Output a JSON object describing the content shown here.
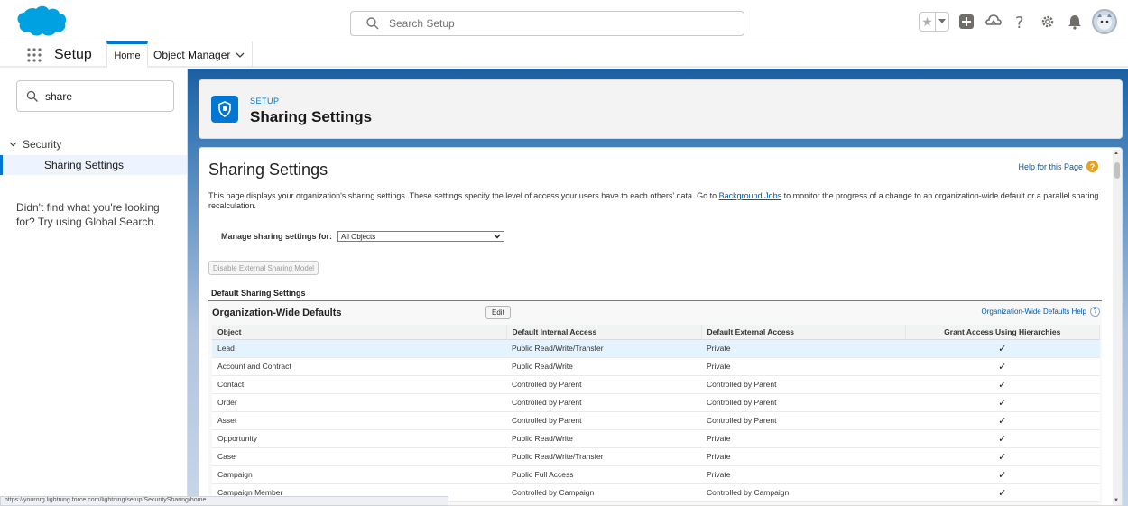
{
  "header": {
    "search_placeholder": "Search Setup",
    "brand_color": "#00a1e0",
    "icons": [
      "star-icon",
      "chevron-down-icon",
      "add-icon",
      "trailhead-icon",
      "help-icon",
      "gear-icon",
      "bell-icon",
      "avatar"
    ]
  },
  "nav": {
    "app_name": "Setup",
    "tabs": [
      {
        "label": "Home",
        "active": true
      },
      {
        "label": "Object Manager",
        "active": false
      }
    ]
  },
  "sidebar": {
    "quick_find_value": "share",
    "tree": {
      "label": "Security",
      "child": "Sharing Settings"
    },
    "not_found_text": "Didn't find what you're looking for? Try using Global Search."
  },
  "page_header": {
    "breadcrumb": "SETUP",
    "title": "Sharing Settings"
  },
  "content": {
    "title": "Sharing Settings",
    "help_link": "Help for this Page",
    "description_before": "This page displays your organization's sharing settings. These settings specify the level of access your users have to each others' data. Go to ",
    "description_link": "Background Jobs",
    "description_after": " to monitor the progress of a change to an organization-wide default or a parallel sharing recalculation.",
    "manage_label": "Manage sharing settings for:",
    "manage_value": "All Objects",
    "disable_button": "Disable External Sharing Model",
    "section_label": "Default Sharing Settings"
  },
  "owd": {
    "title": "Organization-Wide Defaults",
    "edit_button": "Edit",
    "help_link": "Organization-Wide Defaults Help",
    "columns": [
      "Object",
      "Default Internal Access",
      "Default External Access",
      "Grant Access Using Hierarchies"
    ],
    "rows": [
      {
        "object": "Lead",
        "internal": "Public Read/Write/Transfer",
        "external": "Private",
        "grant": "✓",
        "highlight": true
      },
      {
        "object": "Account and Contract",
        "internal": "Public Read/Write",
        "external": "Private",
        "grant": "✓"
      },
      {
        "object": "Contact",
        "internal": "Controlled by Parent",
        "external": "Controlled by Parent",
        "grant": "✓"
      },
      {
        "object": "Order",
        "internal": "Controlled by Parent",
        "external": "Controlled by Parent",
        "grant": "✓"
      },
      {
        "object": "Asset",
        "internal": "Controlled by Parent",
        "external": "Controlled by Parent",
        "grant": "✓"
      },
      {
        "object": "Opportunity",
        "internal": "Public Read/Write",
        "external": "Private",
        "grant": "✓"
      },
      {
        "object": "Case",
        "internal": "Public Read/Write/Transfer",
        "external": "Private",
        "grant": "✓"
      },
      {
        "object": "Campaign",
        "internal": "Public Full Access",
        "external": "Private",
        "grant": "✓"
      },
      {
        "object": "Campaign Member",
        "internal": "Controlled by Campaign",
        "external": "Controlled by Campaign",
        "grant": "✓"
      }
    ]
  },
  "status_bar_url": "https://yourorg.lightning.force.com/lightning/setup/SecuritySharing/home"
}
